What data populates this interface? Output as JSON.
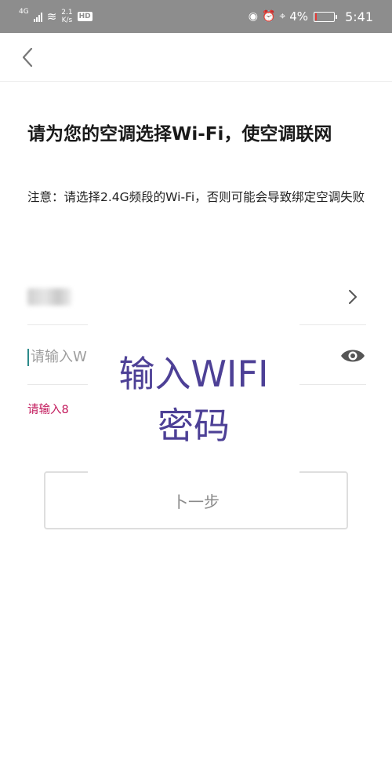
{
  "status_bar": {
    "network_type": "4G",
    "speed_value": "2.1",
    "speed_unit": "K/s",
    "hd_label": "HD",
    "battery_text": "4%",
    "time": "5:41"
  },
  "title": "请为您的空调选择Wi-Fi，使空调联网",
  "notice": "注意：请选择2.4G频段的Wi-Fi，否则可能会导致绑定空调失败",
  "wifi_name": {
    "value": "",
    "blurred": true
  },
  "password": {
    "placeholder": "请输入W",
    "value": ""
  },
  "error_message": "请输入8",
  "next_button": {
    "label": "卜一步"
  },
  "overlay": {
    "line1": "输入WIFI",
    "line2": "密码",
    "color": "#4d4096"
  },
  "colors": {
    "status_bar_bg": "#8d8d8d",
    "error": "#c2185b",
    "cursor": "#2c8a8a"
  }
}
